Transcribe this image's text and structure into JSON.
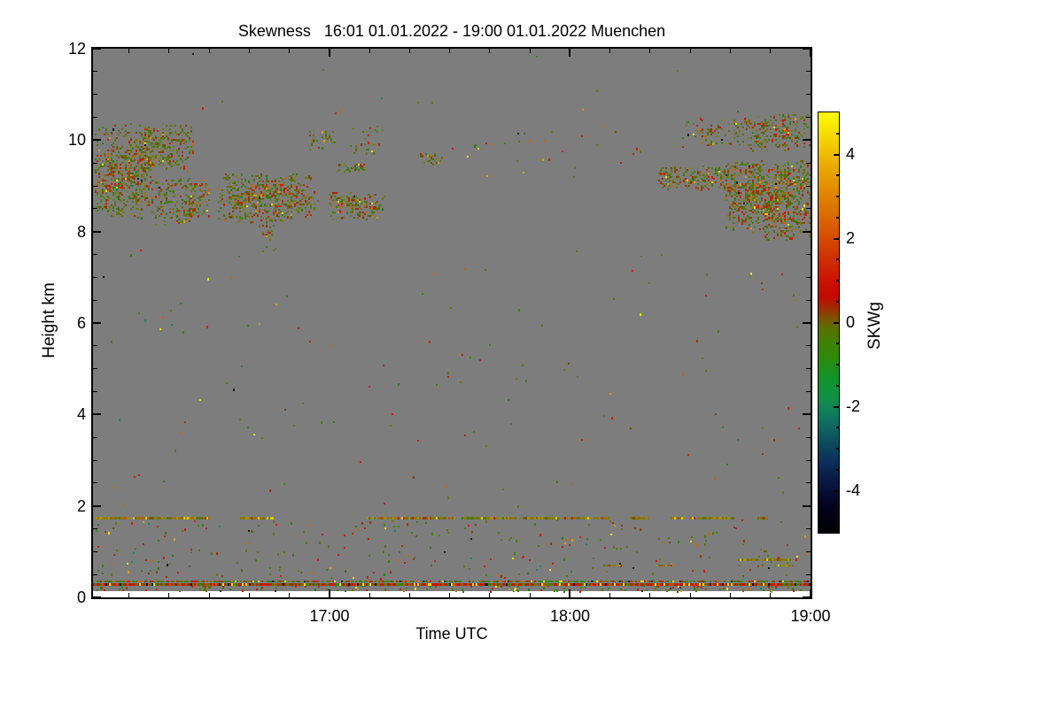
{
  "chart_data": {
    "type": "heatmap",
    "title": "Skewness   16:01 01.01.2022 - 19:00 01.01.2022 Muenchen",
    "xlabel": "Time UTC",
    "ylabel": "Height km",
    "x_range_hours_utc": [
      16.0167,
      19.0
    ],
    "x_tick_labels": [
      "17:00",
      "18:00",
      "19:00"
    ],
    "x_tick_hours": [
      17,
      18,
      19
    ],
    "x_minor_tick_minutes": 10,
    "ylim_km": [
      0,
      12
    ],
    "y_tick_labels": [
      "0",
      "2",
      "4",
      "6",
      "8",
      "10",
      "12"
    ],
    "y_tick_values": [
      0,
      2,
      4,
      6,
      8,
      10,
      12
    ],
    "y_minor_tick_km": 0.5,
    "grid": false,
    "background_color": "#7d7d7d",
    "frame_color": "#000000",
    "text_color": "#000000",
    "colorbar": {
      "label": "SKWg",
      "range": [
        -5,
        5
      ],
      "tick_values": [
        -4,
        -2,
        0,
        2,
        4
      ],
      "tick_labels": [
        "-4",
        "-2",
        "0",
        "2",
        "4"
      ],
      "minor_tick_step": 0.5,
      "stops": [
        [
          -5.0,
          "#000000"
        ],
        [
          -4.4,
          "#03031d"
        ],
        [
          -4.0,
          "#070f38"
        ],
        [
          -3.4,
          "#0b2a58"
        ],
        [
          -2.8,
          "#0e4f60"
        ],
        [
          -2.2,
          "#107a60"
        ],
        [
          -1.8,
          "#119048"
        ],
        [
          -1.3,
          "#129328"
        ],
        [
          -0.8,
          "#2e8a08"
        ],
        [
          -0.4,
          "#447e00"
        ],
        [
          -0.1,
          "#5d6e00"
        ],
        [
          0.1,
          "#7c5200"
        ],
        [
          0.35,
          "#a02b00"
        ],
        [
          0.6,
          "#c30800"
        ],
        [
          1.0,
          "#cc1200"
        ],
        [
          1.6,
          "#d03400"
        ],
        [
          2.2,
          "#d75700"
        ],
        [
          3.0,
          "#e08200"
        ],
        [
          3.8,
          "#ecae00"
        ],
        [
          4.5,
          "#f7dd00"
        ],
        [
          5.0,
          "#fdfd00"
        ]
      ]
    },
    "palettes": {
      "cloud": [
        [
          "#6f6f12",
          20
        ],
        [
          "#7d7d1a",
          10
        ],
        [
          "#5d6b08",
          10
        ],
        [
          "#3f7f00",
          14
        ],
        [
          "#55851c",
          8
        ],
        [
          "#2e7a0a",
          6
        ],
        [
          "#b62600",
          12
        ],
        [
          "#cc2000",
          6
        ],
        [
          "#8a3c00",
          5
        ],
        [
          "#c56700",
          5
        ],
        [
          "#dca000",
          2
        ],
        [
          "#e8e400",
          1
        ],
        [
          "#151515",
          0.6
        ],
        [
          "#0f8a68",
          0.4
        ]
      ],
      "dash": [
        [
          "#8a7a00",
          40
        ],
        [
          "#6f6f12",
          20
        ],
        [
          "#a89000",
          15
        ],
        [
          "#b62600",
          10
        ],
        [
          "#3f7f00",
          6
        ],
        [
          "#e0c800",
          5
        ],
        [
          "#cc4a00",
          4
        ]
      ],
      "surfTop": [
        [
          "#2f8a00",
          25
        ],
        [
          "#3f7f00",
          15
        ],
        [
          "#6f6f12",
          18
        ],
        [
          "#b62600",
          18
        ],
        [
          "#cc2000",
          8
        ],
        [
          "#e8e400",
          6
        ],
        [
          "#c56700",
          5
        ],
        [
          "#151515",
          5
        ]
      ],
      "surfBot": [
        [
          "#c41800",
          28
        ],
        [
          "#b62600",
          17
        ],
        [
          "#3f7f00",
          12
        ],
        [
          "#2f8a00",
          6
        ],
        [
          "#6f6f12",
          10
        ],
        [
          "#cc4a00",
          10
        ],
        [
          "#e8e400",
          9
        ],
        [
          "#151515",
          8
        ]
      ],
      "speck": [
        [
          "#3f7f00",
          22
        ],
        [
          "#6f6f12",
          18
        ],
        [
          "#b62600",
          16
        ],
        [
          "#2e7a0a",
          10
        ],
        [
          "#c56700",
          8
        ],
        [
          "#8a3c00",
          6
        ],
        [
          "#e8e400",
          4
        ],
        [
          "#0f8a68",
          4
        ],
        [
          "#cc2000",
          6
        ],
        [
          "#dca000",
          3
        ],
        [
          "#151515",
          3
        ]
      ]
    },
    "features": [
      {
        "kind": "cloud",
        "t": [
          16.02,
          16.44
        ],
        "h": [
          9.3,
          10.4
        ],
        "density": 0.5
      },
      {
        "kind": "cloud",
        "t": [
          16.02,
          16.27
        ],
        "h": [
          8.3,
          9.75
        ],
        "density": 0.8
      },
      {
        "kind": "cloud",
        "t": [
          16.27,
          16.5
        ],
        "h": [
          8.15,
          9.2
        ],
        "density": 0.75
      },
      {
        "kind": "cloud",
        "t": [
          16.53,
          16.95
        ],
        "h": [
          8.2,
          9.3
        ],
        "density": 0.75
      },
      {
        "kind": "cloud",
        "t": [
          16.7,
          16.78
        ],
        "h": [
          7.5,
          8.25
        ],
        "density": 0.3
      },
      {
        "kind": "cloud",
        "t": [
          16.91,
          17.03
        ],
        "h": [
          9.78,
          10.3
        ],
        "density": 0.35
      },
      {
        "kind": "cloud",
        "t": [
          17.08,
          17.23
        ],
        "h": [
          9.7,
          10.35
        ],
        "density": 0.35
      },
      {
        "kind": "cloud",
        "t": [
          17.01,
          17.15
        ],
        "h": [
          9.28,
          9.55
        ],
        "density": 0.85
      },
      {
        "kind": "cloud",
        "t": [
          16.99,
          17.23
        ],
        "h": [
          8.25,
          8.9
        ],
        "density": 0.6
      },
      {
        "kind": "cloud",
        "t": [
          17.37,
          17.47
        ],
        "h": [
          9.45,
          9.75
        ],
        "density": 0.7
      },
      {
        "kind": "cloud",
        "t": [
          18.36,
          18.7
        ],
        "h": [
          8.9,
          9.48
        ],
        "density": 0.8
      },
      {
        "kind": "cloud",
        "t": [
          18.46,
          18.76
        ],
        "h": [
          9.82,
          10.52
        ],
        "density": 0.3
      },
      {
        "kind": "cloud",
        "t": [
          18.73,
          19.0
        ],
        "h": [
          9.75,
          10.6
        ],
        "density": 0.72
      },
      {
        "kind": "cloud",
        "t": [
          18.64,
          19.0
        ],
        "h": [
          8.0,
          9.6
        ],
        "density": 0.85
      },
      {
        "kind": "cloud",
        "t": [
          18.78,
          19.0
        ],
        "h": [
          7.8,
          8.1
        ],
        "density": 0.45
      },
      {
        "kind": "speckle",
        "t": [
          16.05,
          18.95
        ],
        "h": [
          10.55,
          11.9
        ],
        "count": 14
      },
      {
        "kind": "speckle",
        "t": [
          17.5,
          18.35
        ],
        "h": [
          9.2,
          10.35
        ],
        "count": 30
      },
      {
        "kind": "speckle",
        "t": [
          16.05,
          18.97
        ],
        "h": [
          2.0,
          7.6
        ],
        "count": 130
      },
      {
        "kind": "speckle",
        "t": [
          16.03,
          18.98
        ],
        "h": [
          0.42,
          1.7
        ],
        "count": 260
      },
      {
        "kind": "speckle",
        "t": [
          16.03,
          18.98
        ],
        "h": [
          0.14,
          0.28
        ],
        "count": 150
      },
      {
        "kind": "dashes",
        "h": 1.76,
        "thickness": 3,
        "segments": [
          [
            16.03,
            16.165
          ],
          [
            16.185,
            16.34
          ],
          [
            16.35,
            16.5
          ],
          [
            16.63,
            16.775
          ],
          [
            17.155,
            17.23
          ],
          [
            17.24,
            17.42
          ],
          [
            17.43,
            17.52
          ],
          [
            17.55,
            17.78
          ],
          [
            17.8,
            17.95
          ],
          [
            17.97,
            18.08
          ],
          [
            18.1,
            18.16
          ],
          [
            18.25,
            18.33
          ],
          [
            18.42,
            18.47
          ],
          [
            18.5,
            18.6
          ],
          [
            18.61,
            18.68
          ],
          [
            18.78,
            18.82
          ]
        ]
      },
      {
        "kind": "dashes",
        "h": 0.845,
        "thickness": 3,
        "segments": [
          [
            18.7,
            18.92
          ]
        ]
      },
      {
        "kind": "dashes",
        "h": 0.72,
        "thickness": 2,
        "segments": [
          [
            18.14,
            18.21
          ],
          [
            18.36,
            18.43
          ],
          [
            18.85,
            18.93
          ]
        ]
      },
      {
        "kind": "surface",
        "t": [
          16.0167,
          19.0
        ],
        "h_top": 0.37,
        "h_bot": 0.31
      }
    ]
  }
}
